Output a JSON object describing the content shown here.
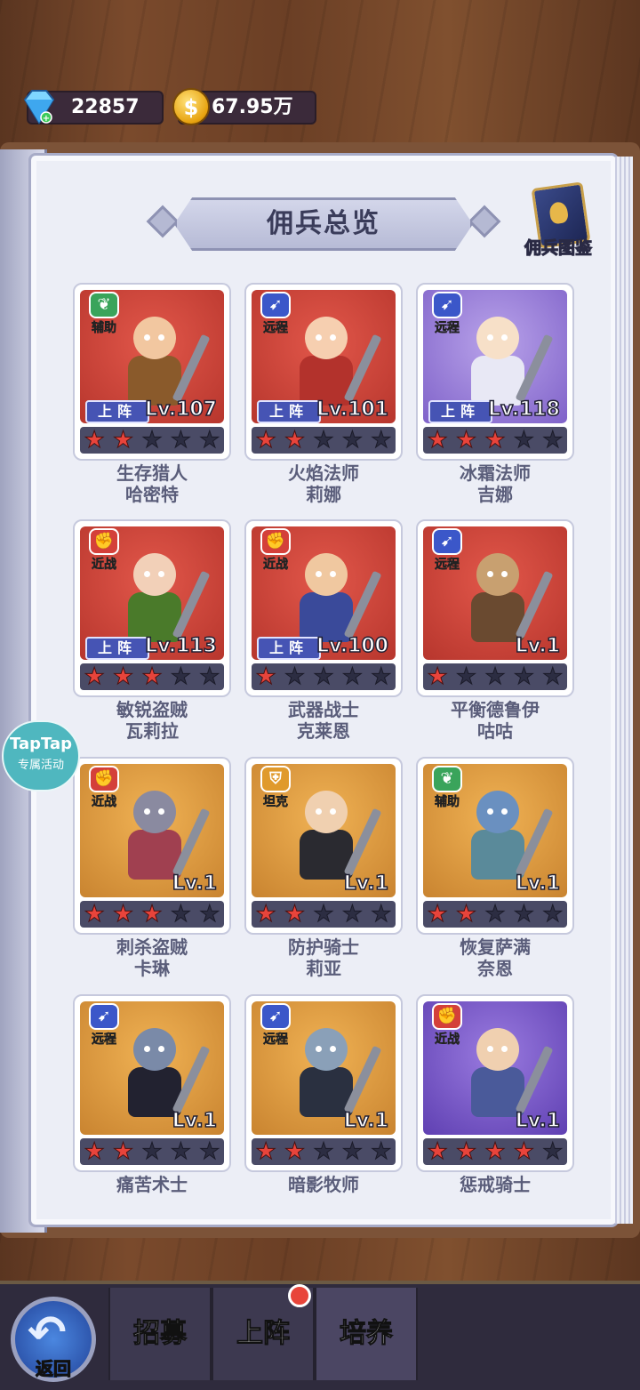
{
  "currency": {
    "gems": "22857",
    "gold": "67.95万",
    "gem_icon": "diamond-gem-icon",
    "gold_icon": "gold-coin-icon",
    "gold_symbol": "$"
  },
  "title": "佣兵总览",
  "codex_label": "佣兵图鉴",
  "deploy_label": "上阵",
  "taptap": {
    "line1": "TapTap",
    "line2": "专属活动"
  },
  "heroes": [
    {
      "role": "辅助",
      "role_icon": "leaf-icon",
      "level": "Lv.107",
      "deployed": true,
      "stars": 2,
      "name1": "生存猎人",
      "name2": "哈密特",
      "bg": "red"
    },
    {
      "role": "远程",
      "role_icon": "bow-icon",
      "level": "Lv.101",
      "deployed": true,
      "stars": 2,
      "name1": "火焰法师",
      "name2": "莉娜",
      "bg": "red"
    },
    {
      "role": "远程",
      "role_icon": "bow-icon",
      "level": "Lv.118",
      "deployed": true,
      "stars": 3,
      "name1": "冰霜法师",
      "name2": "吉娜",
      "bg": "purple"
    },
    {
      "role": "近战",
      "role_icon": "fist-icon",
      "level": "Lv.113",
      "deployed": true,
      "stars": 3,
      "name1": "敏锐盗贼",
      "name2": "瓦莉拉",
      "bg": "red"
    },
    {
      "role": "近战",
      "role_icon": "fist-icon",
      "level": "Lv.100",
      "deployed": true,
      "stars": 1,
      "name1": "武器战士",
      "name2": "克莱恩",
      "bg": "red"
    },
    {
      "role": "远程",
      "role_icon": "bow-icon",
      "level": "Lv.1",
      "deployed": false,
      "stars": 1,
      "name1": "平衡德鲁伊",
      "name2": "咕咕",
      "bg": "red"
    },
    {
      "role": "近战",
      "role_icon": "fist-icon",
      "level": "Lv.1",
      "deployed": false,
      "stars": 3,
      "name1": "刺杀盗贼",
      "name2": "卡琳",
      "bg": "gold"
    },
    {
      "role": "坦克",
      "role_icon": "shield-icon",
      "level": "Lv.1",
      "deployed": false,
      "stars": 2,
      "name1": "防护骑士",
      "name2": "莉亚",
      "bg": "gold"
    },
    {
      "role": "辅助",
      "role_icon": "leaf-icon",
      "level": "Lv.1",
      "deployed": false,
      "stars": 2,
      "name1": "恢复萨满",
      "name2": "奈恩",
      "bg": "gold"
    },
    {
      "role": "远程",
      "role_icon": "bow-icon",
      "level": "Lv.1",
      "deployed": false,
      "stars": 2,
      "name1": "痛苦术士",
      "name2": "",
      "bg": "gold"
    },
    {
      "role": "远程",
      "role_icon": "bow-icon",
      "level": "Lv.1",
      "deployed": false,
      "stars": 2,
      "name1": "暗影牧师",
      "name2": "",
      "bg": "gold"
    },
    {
      "role": "近战",
      "role_icon": "fist-icon",
      "level": "Lv.1",
      "deployed": false,
      "stars": 4,
      "name1": "惩戒骑士",
      "name2": "",
      "bg": "violet"
    }
  ],
  "nav": {
    "back_label": "返回",
    "tabs": [
      "招募",
      "上阵",
      "培养"
    ],
    "badge_tab": "上阵"
  }
}
